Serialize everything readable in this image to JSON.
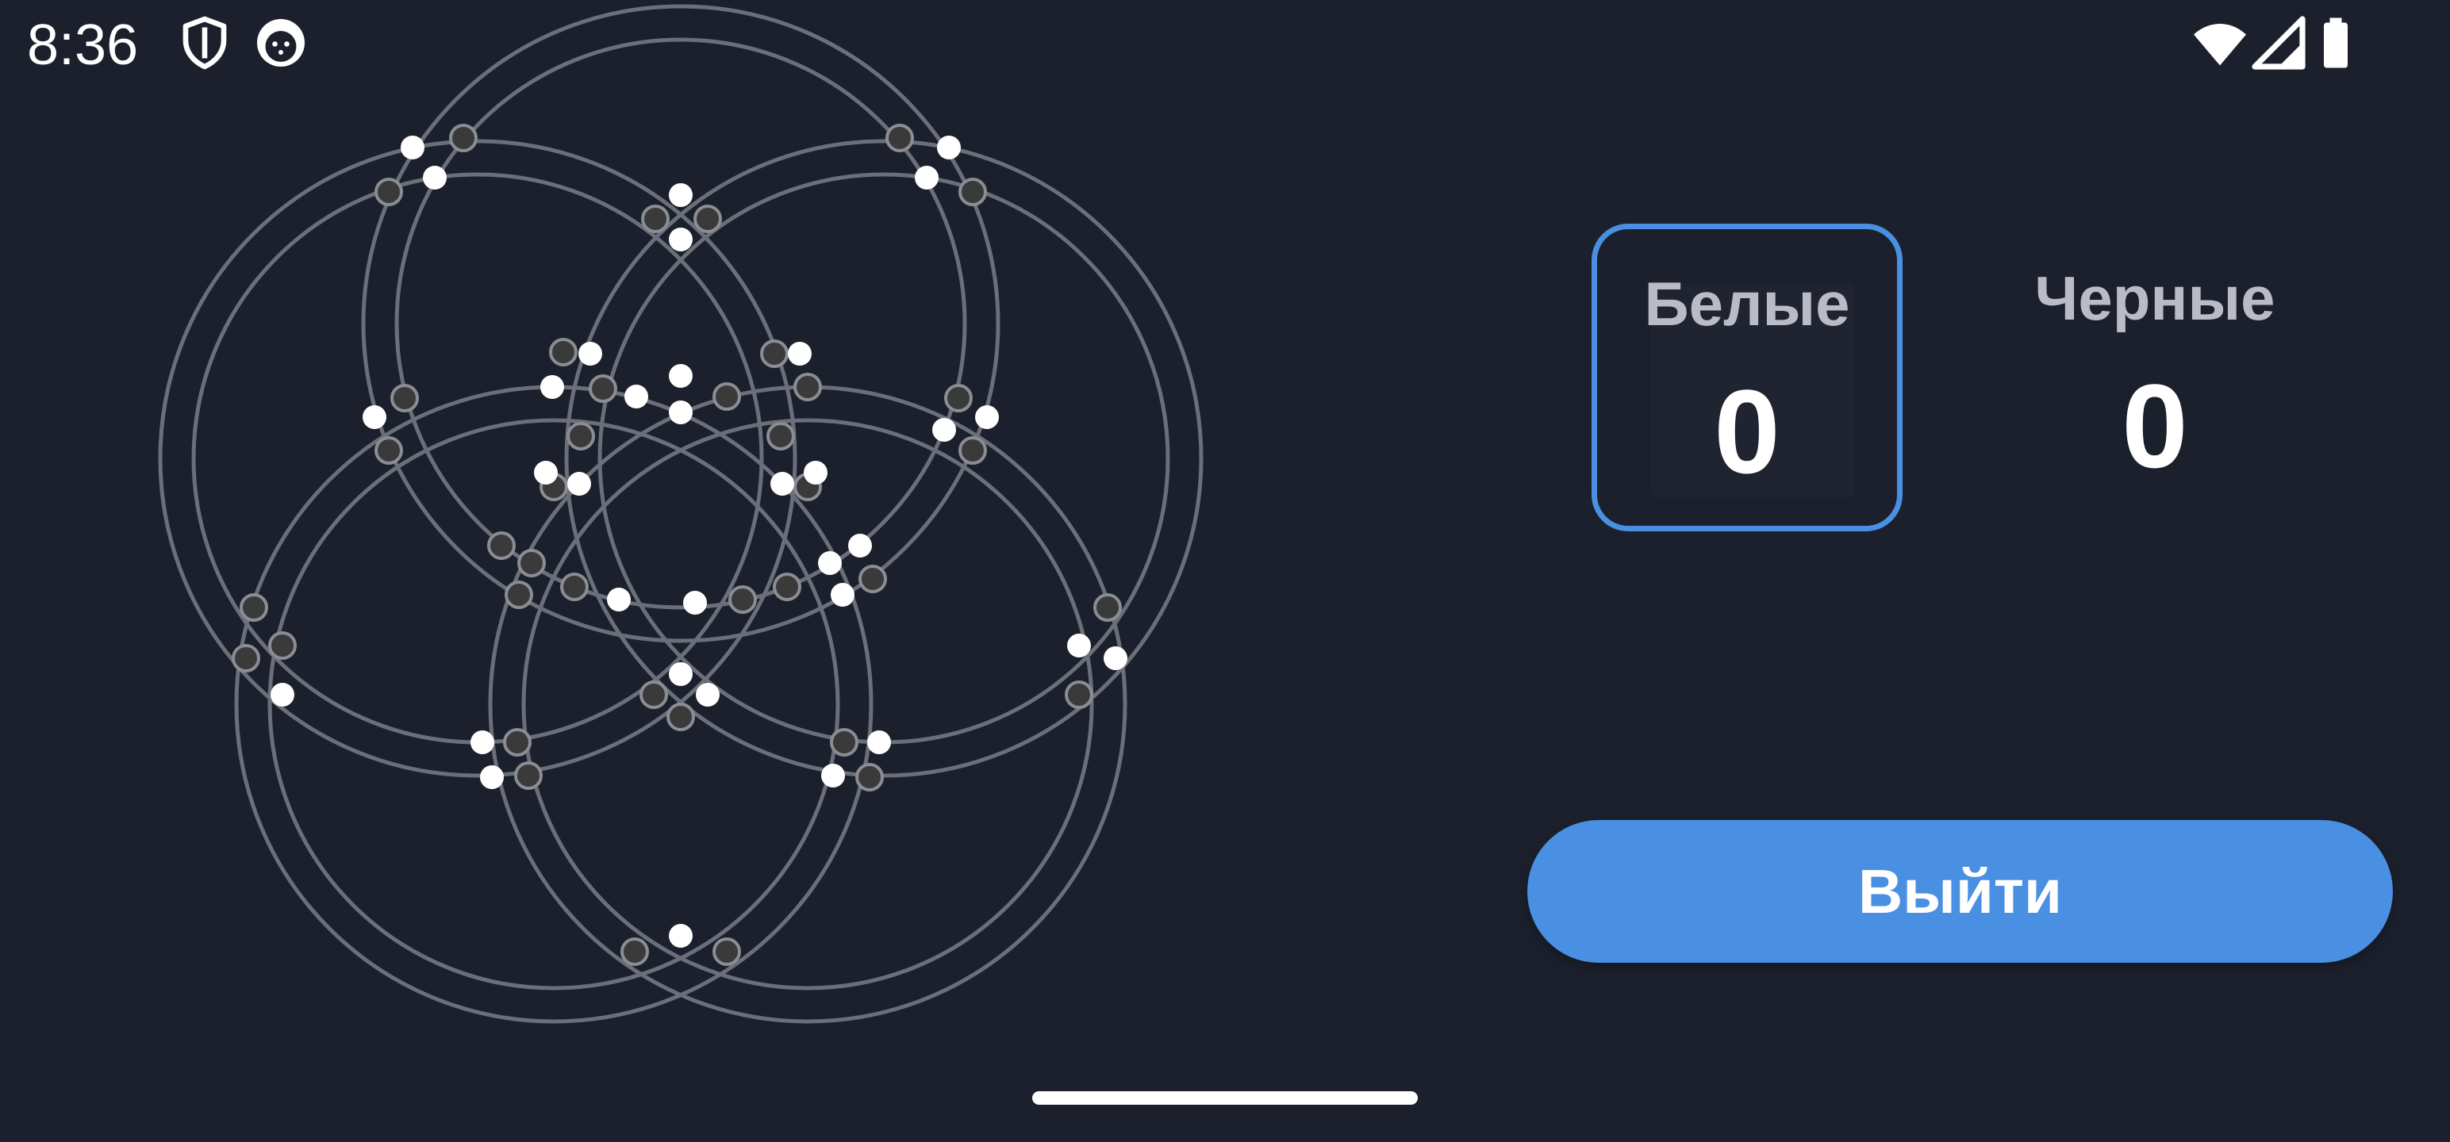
{
  "status_bar": {
    "time": "8:36",
    "left_icons": [
      "shield-icon",
      "cat-face-icon"
    ],
    "right_icons": [
      "wifi-icon",
      "cell-signal-icon",
      "battery-icon"
    ]
  },
  "scores": {
    "white_label": "Белые",
    "white_value": "0",
    "black_label": "Черные",
    "black_value": "0",
    "active_player": "white"
  },
  "actions": {
    "exit_label": "Выйти"
  },
  "board": {
    "rings": 5,
    "points": [
      {
        "c": "w"
      },
      {
        "c": "b"
      },
      {
        "c": "w"
      },
      {
        "c": "b"
      },
      {
        "c": "b"
      },
      {
        "c": "w"
      },
      {
        "c": "b"
      },
      {
        "c": "w"
      },
      {
        "c": "w"
      },
      {
        "c": "b"
      },
      {
        "c": "w"
      },
      {
        "c": "b"
      },
      {
        "c": "w"
      },
      {
        "c": "b"
      },
      {
        "c": "b"
      },
      {
        "c": "w"
      },
      {
        "c": "b"
      },
      {
        "c": "w"
      },
      {
        "c": "b"
      },
      {
        "c": "b"
      },
      {
        "c": "w"
      },
      {
        "c": "b"
      },
      {
        "c": "w"
      },
      {
        "c": "w"
      },
      {
        "c": "b"
      },
      {
        "c": "b"
      },
      {
        "c": "w"
      },
      {
        "c": "b"
      },
      {
        "c": "w"
      },
      {
        "c": "w"
      },
      {
        "c": "b"
      },
      {
        "c": "b"
      },
      {
        "c": "b"
      },
      {
        "c": "b"
      },
      {
        "c": "w"
      },
      {
        "c": "w"
      },
      {
        "c": "w"
      },
      {
        "c": "w"
      },
      {
        "c": "b"
      },
      {
        "c": "b"
      },
      {
        "c": "b"
      },
      {
        "c": "b"
      },
      {
        "c": "w"
      },
      {
        "c": "w"
      },
      {
        "c": "b"
      },
      {
        "c": "b"
      },
      {
        "c": "w"
      },
      {
        "c": "w"
      },
      {
        "c": "w"
      },
      {
        "c": "b"
      },
      {
        "c": "b"
      },
      {
        "c": "b"
      },
      {
        "c": "b"
      },
      {
        "c": "w"
      },
      {
        "c": "b"
      },
      {
        "c": "w"
      },
      {
        "c": "w"
      },
      {
        "c": "b"
      },
      {
        "c": "w"
      },
      {
        "c": "b"
      },
      {
        "c": "b"
      },
      {
        "c": "w"
      },
      {
        "c": "w"
      },
      {
        "c": "b"
      },
      {
        "c": "w"
      },
      {
        "c": "b"
      },
      {
        "c": "b"
      },
      {
        "c": "w"
      },
      {
        "c": "b"
      },
      {
        "c": "w"
      },
      {
        "c": "b"
      },
      {
        "c": "w"
      },
      {
        "c": "b"
      }
    ]
  },
  "colors": {
    "background": "#1b202c",
    "accent": "#4a90e2",
    "ring_stroke": "#6b6f7a",
    "white_stone": "#ffffff",
    "empty_point": "#3a3a3a"
  }
}
